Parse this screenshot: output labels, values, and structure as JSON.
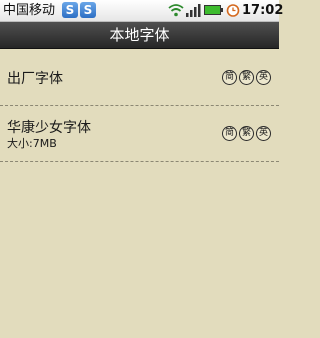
{
  "status_bar": {
    "carrier": "中国移动",
    "notification_icons": [
      "notification-s-icon",
      "notification-s-icon"
    ],
    "notification_label": "S",
    "time": "17:02"
  },
  "header": {
    "title": "本地字体"
  },
  "fonts": [
    {
      "name": "出厂字体",
      "size": "",
      "badges": [
        "简",
        "繁",
        "英"
      ]
    },
    {
      "name": "华康少女字体",
      "size": "大小:7MB",
      "badges": [
        "简",
        "繁",
        "英"
      ]
    }
  ]
}
